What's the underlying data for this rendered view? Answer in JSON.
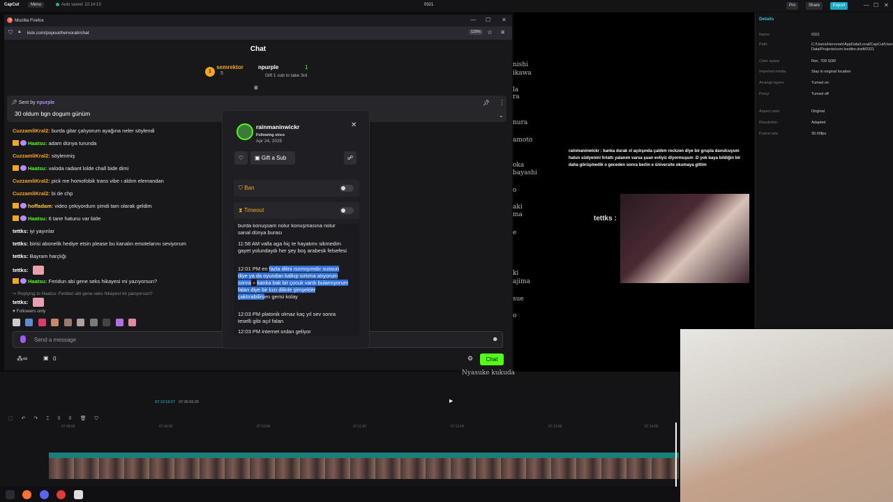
{
  "capcut": {
    "logo": "CapCut",
    "menu": "Menu",
    "autosave": "Auto saved: 22:14:13",
    "project": "0321",
    "pro": "Pro",
    "share": "Share",
    "export": "Export",
    "details_title": "Details",
    "details": [
      {
        "k": "Name:",
        "v": "0321"
      },
      {
        "k": "Path:",
        "v": "C:/Users/Hervorah/AppData/Local/CapCut/User Data/Projects/com.lveditor.draft/0321"
      },
      {
        "k": "Color space",
        "v": "Rec. 709 SDR"
      },
      {
        "k": "Imported media:",
        "v": "Stay in original location"
      },
      {
        "k": "Arrange layers",
        "v": "Turned on"
      },
      {
        "k": "Proxy:",
        "v": "Turned off"
      },
      {
        "k": "Aspect ratio:",
        "v": "Original"
      },
      {
        "k": "Resolution:",
        "v": "Adapted"
      },
      {
        "k": "Frame rate:",
        "v": "30.00fps"
      }
    ],
    "timecode_current": "07:12:19:27",
    "timecode_total": "07:36:55:26",
    "ruler": [
      "07:08:00",
      "07:09:00",
      "07:10:00",
      "07:11:00",
      "07:12:00",
      "07:13:00",
      "07:14:00"
    ]
  },
  "firefox": {
    "title": "Mozilla Firefox",
    "url": "kick.com/popout/hervorah/chat",
    "zoom": "120%"
  },
  "kick": {
    "chat_title": "Chat",
    "top_gifter": {
      "rank": "1",
      "name": "semrektor",
      "count": "5"
    },
    "second": {
      "name": "npurple",
      "count": "1",
      "hint": "Gift 1 sub to take 3rd"
    },
    "pinned": {
      "sent_by": "Sent by",
      "user": "npurple",
      "message": "30 oldum bgn dogum günüm"
    },
    "messages": [
      {
        "user": "CuzzamliKral2:",
        "text": "burda gitar çalıyorum ayağına neler söylendi",
        "color": "orange"
      },
      {
        "user": "Haatsu:",
        "text": "adam dünya turunda",
        "color": "green"
      },
      {
        "user": "CuzzamliKral2:",
        "text": "söylenmiş",
        "color": "orange"
      },
      {
        "user": "Haatsu:",
        "text": "valoda radiant lolde chall bide dimi",
        "color": "green"
      },
      {
        "user": "CuzzamliKral2:",
        "text": "pick me homofobik trans vibe ı aldım elemandan",
        "color": "orange"
      },
      {
        "user": "CuzzamliKral2:",
        "text": "bi de chp",
        "color": "orange"
      },
      {
        "user": "hoffadam:",
        "text": "video çekiyordum şimdi tam olarak geldim",
        "color": "yellow"
      },
      {
        "user": "Haatsu:",
        "text": "6 tane hatunu var bide",
        "color": "green"
      },
      {
        "user": "tettks:",
        "text": "iyi yayınlar",
        "color": "white"
      },
      {
        "user": "tettks:",
        "text": "birisi abonelik hediye etsin please bu kanalın emotelarını seviyorum",
        "color": "white"
      },
      {
        "user": "tettks:",
        "text": "Bayram harçlığı",
        "color": "white"
      },
      {
        "user": "tettks:",
        "text": "",
        "color": "white"
      },
      {
        "user": "Haatsu:",
        "text": "Feridun abi gene seks hikayesi mi yazıyorsun?",
        "color": "green"
      },
      {
        "user": "",
        "text": "Replying to Haatsu: Feridun abi gene seks hikayesi mi yazıyorsun?",
        "color": "reply"
      },
      {
        "user": "tettks:",
        "text": "",
        "color": "white"
      }
    ],
    "followers_only": "Followers only",
    "send_placeholder": "Send a message",
    "chat_button": "Chat",
    "points": "0"
  },
  "popup": {
    "username": "rainmaninwickr",
    "following_since_label": "Following since",
    "following_since": "Apr 24, 2025",
    "gift_sub": "Gift a Sub",
    "ban": "Ban",
    "timeout": "Timeout",
    "history": [
      {
        "time": "",
        "text": "burda konuşsam nolur konuşmasına nolur sanal dünya burası"
      },
      {
        "time": "11:58 AM",
        "text": "valla aga hiç te hayatımı sikmedim gayet yolundaydı her şey boş arabesk felsefesi"
      },
      {
        "time": "12:01 PM",
        "text_pre": "en ",
        "text_sel": "fazla dilini ısırmışımdır sussun diye ya da oyundan kalkıp sırtıma atıyorum sonra",
        "text_sel2": "kanka bak bir çocuk vardı bulamıyorum falan diye bir kızı dilinle şimşekler çaktırabilirs",
        "text_post": "en gerisi kolay"
      },
      {
        "time": "12:03 PM",
        "text": "platonik olmaz kaç yıl sev sonra teselli gibi açıl falan"
      },
      {
        "time": "12:03 PM",
        "text": "internet ordan geliyor"
      }
    ]
  },
  "overlay": {
    "message_user": "rainmaninwickr :",
    "message_text": "kanka durak xl açılışında çaldım rockzen diye bir grupla davulcuyum hatun südyenini fırlattı yalanım varsa şuan evliyiz diyormuşum :D yok baya bildiğin bir daha görüşmedik o geceden sonra berlin e üniversite okumaya gittim",
    "stream_user": "tettks :",
    "credits": [
      "nishi",
      "ikawa",
      "la",
      "ra",
      "nura",
      "amoto",
      "oka",
      "bayashi",
      "o",
      "aki",
      "ma",
      "e",
      "ki",
      "ajima",
      "sue",
      "o",
      "Nyasuke kukuda"
    ]
  }
}
